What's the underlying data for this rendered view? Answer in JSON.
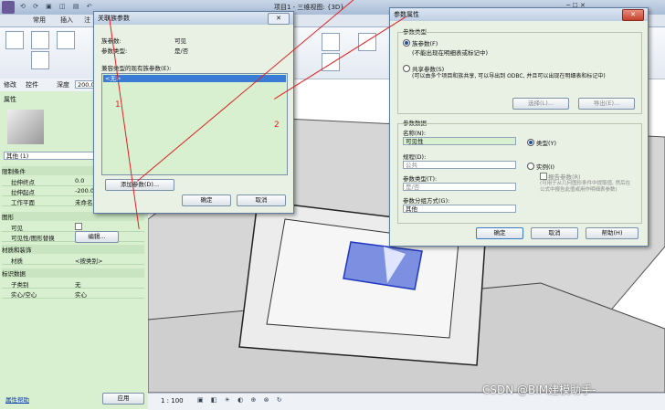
{
  "app": {
    "title": "项目1 - 三维视图: {3D}",
    "tabs": [
      "常用",
      "插入",
      "注"
    ]
  },
  "options_bar": {
    "modify": "修改",
    "control": "控件",
    "depth_label": "深度",
    "depth_value": "200.0"
  },
  "properties": {
    "header": "属性",
    "type_selector": "其他 (1)",
    "sections": [
      {
        "title": "限制条件",
        "rows": [
          {
            "k": "拉伸终点",
            "v": "0.0"
          },
          {
            "k": "拉伸起点",
            "v": "-200.0"
          },
          {
            "k": "工作平面",
            "v": "未命名"
          }
        ]
      },
      {
        "title": "图形",
        "rows": [
          {
            "k": "可见",
            "v": ""
          },
          {
            "k": "可见性/图形替换",
            "v": "编辑..."
          }
        ]
      },
      {
        "title": "材质和装饰",
        "rows": [
          {
            "k": "材质",
            "v": "<按类别>"
          }
        ]
      },
      {
        "title": "标识数据",
        "rows": [
          {
            "k": "子类别",
            "v": "无"
          },
          {
            "k": "实心/空心",
            "v": "实心"
          }
        ]
      }
    ],
    "help_link": "属性帮助",
    "apply_button": "应用"
  },
  "status": {
    "scale": "1 : 100"
  },
  "assoc_dialog": {
    "title": "关联族参数",
    "param_label": "族参数:",
    "param_value": "可见",
    "type_label": "参数类型:",
    "type_value": "是/否",
    "list_label": "兼容类型的现有族参数(E):",
    "list_items": [
      "<无>"
    ],
    "add_param_button": "添加参数(D)...",
    "ok_button": "确定",
    "cancel_button": "取消",
    "close_glyph": "✕"
  },
  "param_dialog": {
    "title": "参数属性",
    "group_type": "参数类型",
    "family_param_label": "族参数(F)",
    "family_param_desc": "(不能出现在明细表或标记中)",
    "shared_param_label": "共享参数(S)",
    "shared_param_desc": "(可以由多个项目和族共享, 可以导出到 ODBC, 并且可以出现在明细表和标记中)",
    "select_button": "选择(L)...",
    "export_button": "导出(E)...",
    "group_data": "参数数据",
    "name_label": "名称(N):",
    "name_value": "可见性",
    "type_radio": "类型(Y)",
    "instance_radio": "实例(I)",
    "discipline_label": "规程(D):",
    "discipline_value": "公共",
    "param_type_label": "参数类型(T):",
    "param_type_value": "是/否",
    "group_label": "参数分组方式(G):",
    "group_value": "其他",
    "report_label": "报告参数(R)",
    "report_desc": "(可用于从几何图形条件中提取值, 然后在公式中报告此值或用作明细表参数)",
    "ok_button": "确定",
    "cancel_button": "取消",
    "help_button": "帮助(H)",
    "close_glyph": "✕"
  },
  "annotations": {
    "one": "1",
    "two": "2"
  },
  "watermark": "CSDN @BIM建模助手-"
}
